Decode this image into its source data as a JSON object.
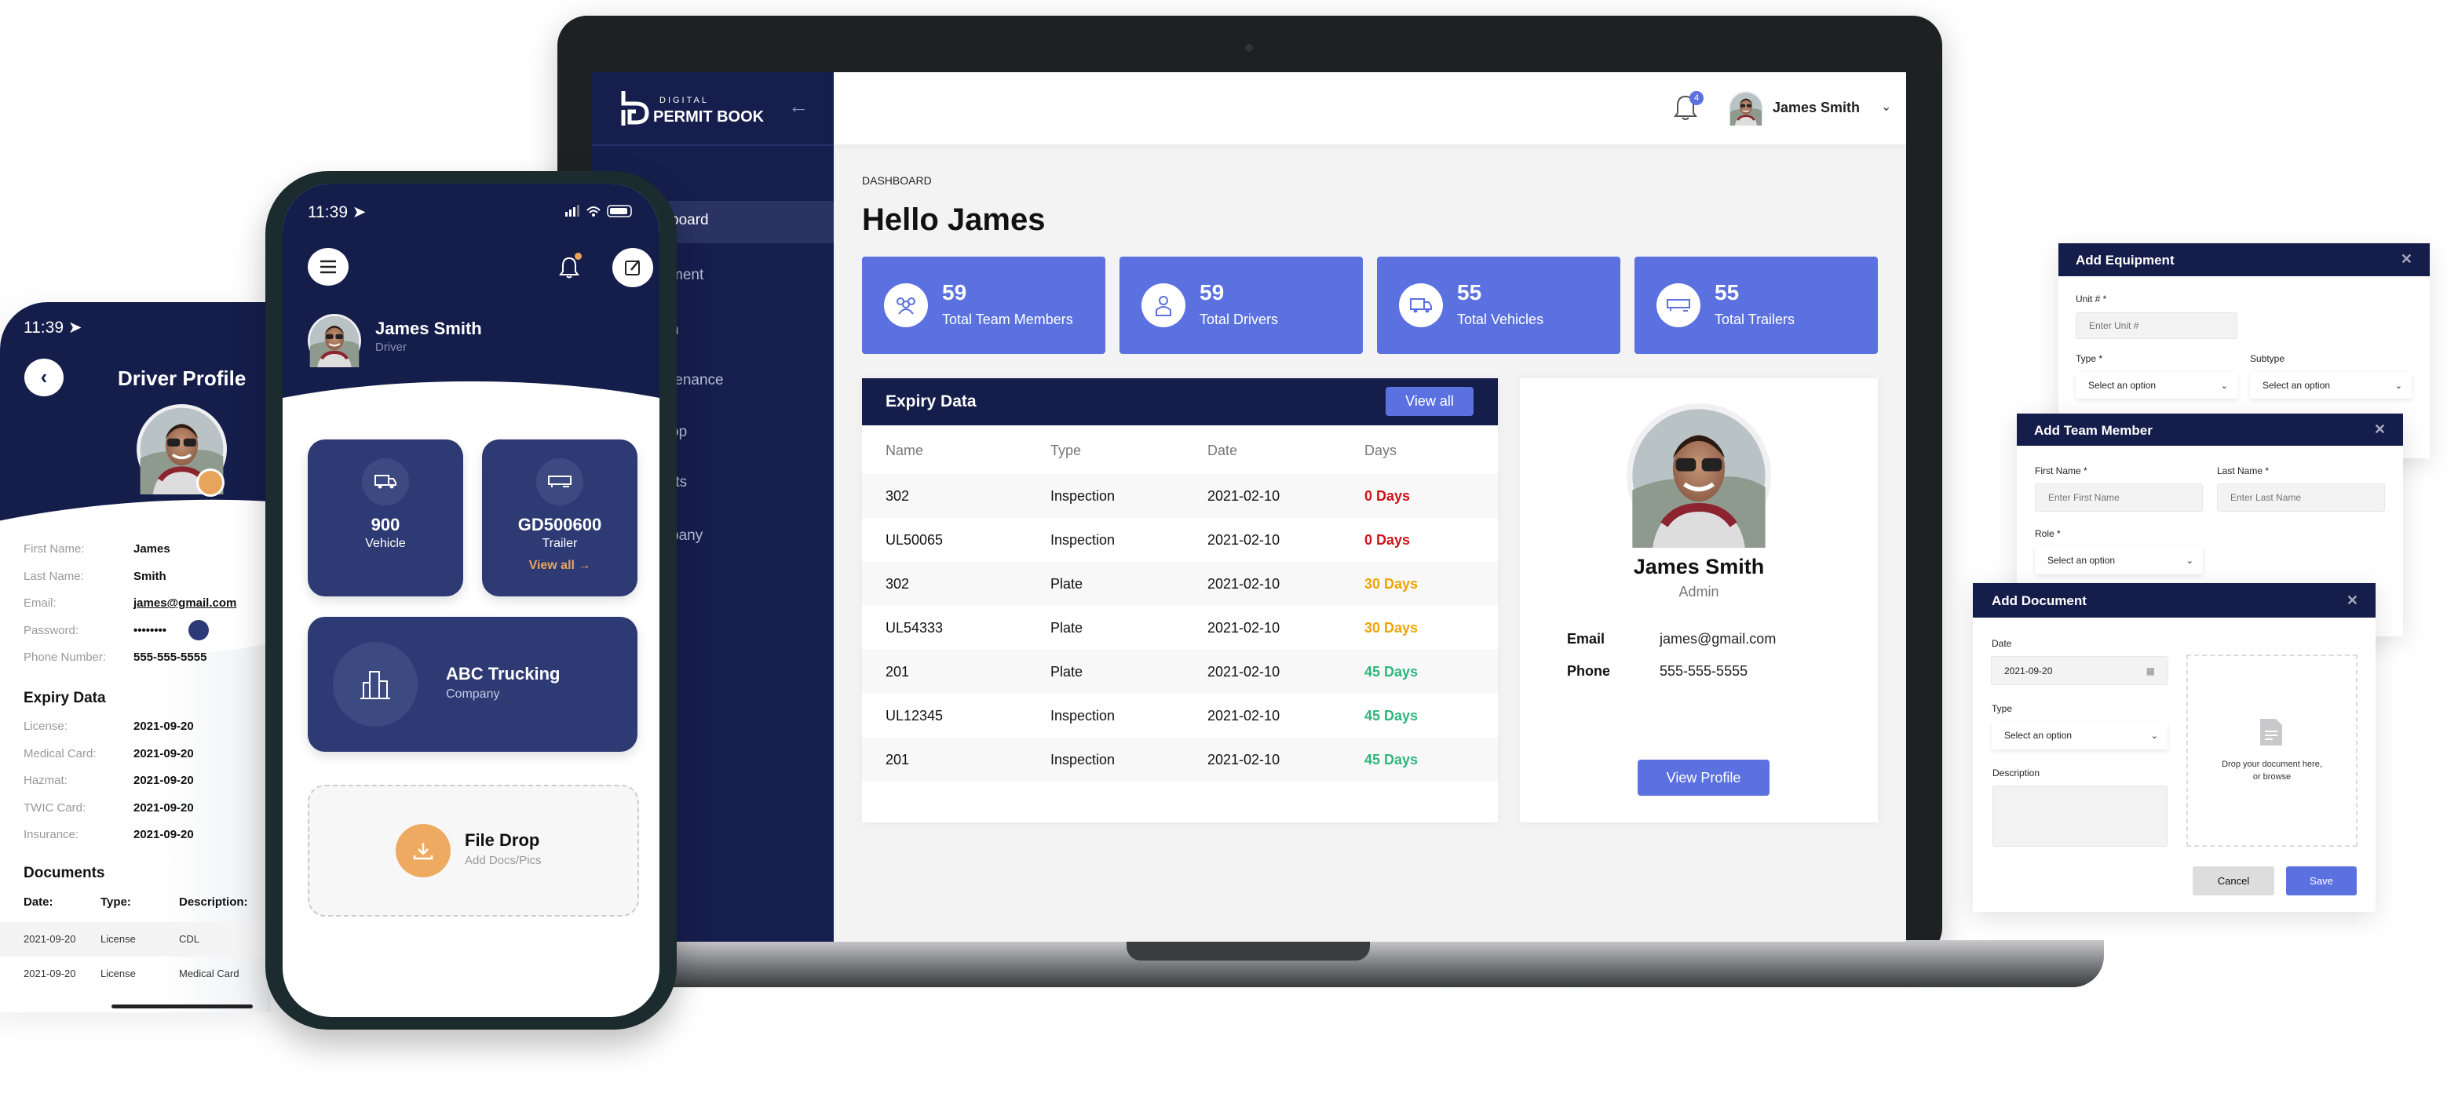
{
  "laptop": {
    "logo": {
      "top": "DIGITAL",
      "main": "PERMIT BOOK"
    },
    "sidebar": {
      "items": [
        {
          "label": "board",
          "active": true
        },
        {
          "label": "ment"
        },
        {
          "label": "n"
        },
        {
          "label": "tenance"
        },
        {
          "label": "op"
        },
        {
          "label": "rts"
        },
        {
          "label": "pany"
        }
      ]
    },
    "header": {
      "notification_count": "4",
      "user_name": "James Smith"
    },
    "breadcrumb": "DASHBOARD",
    "greeting": "Hello James",
    "stats": [
      {
        "value": "59",
        "label": "Total Team Members",
        "icon": "team-icon"
      },
      {
        "value": "59",
        "label": "Total Drivers",
        "icon": "driver-icon"
      },
      {
        "value": "55",
        "label": "Total Vehicles",
        "icon": "truck-icon"
      },
      {
        "value": "55",
        "label": "Total Trailers",
        "icon": "trailer-icon"
      }
    ],
    "expiry": {
      "title": "Expiry Data",
      "view_all": "View all",
      "columns": [
        "Name",
        "Type",
        "Date",
        "Days"
      ],
      "rows": [
        {
          "name": "302",
          "type": "Inspection",
          "date": "2021-02-10",
          "days": "0 Days",
          "color": "#d0121b"
        },
        {
          "name": "UL50065",
          "type": "Inspection",
          "date": "2021-02-10",
          "days": "0 Days",
          "color": "#d0121b"
        },
        {
          "name": "302",
          "type": "Plate",
          "date": "2021-02-10",
          "days": "30 Days",
          "color": "#f0a400"
        },
        {
          "name": "UL54333",
          "type": "Plate",
          "date": "2021-02-10",
          "days": "30 Days",
          "color": "#f0a400"
        },
        {
          "name": "201",
          "type": "Plate",
          "date": "2021-02-10",
          "days": "45 Days",
          "color": "#2fb67c"
        },
        {
          "name": "UL12345",
          "type": "Inspection",
          "date": "2021-02-10",
          "days": "45 Days",
          "color": "#2fb67c"
        },
        {
          "name": "201",
          "type": "Inspection",
          "date": "2021-02-10",
          "days": "45 Days",
          "color": "#2fb67c"
        }
      ]
    },
    "profile": {
      "name": "James Smith",
      "role": "Admin",
      "email_label": "Email",
      "email": "james@gmail.com",
      "phone_label": "Phone",
      "phone": "555-555-5555",
      "button": "View Profile"
    }
  },
  "driver_profile": {
    "time": "11:39",
    "title": "Driver Profile",
    "fields": [
      {
        "label": "First Name:",
        "value": "James"
      },
      {
        "label": "Last Name:",
        "value": "Smith"
      },
      {
        "label": "Email:",
        "value": "james@gmail.com"
      },
      {
        "label": "Password:",
        "value": "••••••••"
      },
      {
        "label": "Phone Number:",
        "value": "555-555-5555"
      }
    ],
    "expiry_heading": "Expiry Data",
    "expiry": [
      {
        "label": "License:",
        "value": "2021-09-20"
      },
      {
        "label": "Medical Card:",
        "value": "2021-09-20"
      },
      {
        "label": "Hazmat:",
        "value": "2021-09-20"
      },
      {
        "label": "TWIC Card:",
        "value": "2021-09-20"
      },
      {
        "label": "Insurance:",
        "value": "2021-09-20"
      }
    ],
    "documents_heading": "Documents",
    "doc_columns": [
      "Date:",
      "Type:",
      "Description:"
    ],
    "documents": [
      {
        "date": "2021-09-20",
        "type": "License",
        "description": "CDL"
      },
      {
        "date": "2021-09-20",
        "type": "License",
        "description": "Medical Card"
      }
    ]
  },
  "mobile": {
    "time": "11:39",
    "user_name": "James Smith",
    "user_role": "Driver",
    "vehicle": {
      "value": "900",
      "label": "Vehicle"
    },
    "trailer": {
      "value": "GD500600",
      "label": "Trailer",
      "link": "View all →"
    },
    "company": {
      "name": "ABC Trucking",
      "label": "Company"
    },
    "file_drop": {
      "title": "File Drop",
      "subtitle": "Add Docs/Pics"
    }
  },
  "modals": {
    "equipment": {
      "title": "Add Equipment",
      "unit_label": "Unit # *",
      "unit_placeholder": "Enter Unit #",
      "type_label": "Type *",
      "type_value": "Select an option",
      "subtype_label": "Subtype",
      "subtype_value": "Select an option"
    },
    "team_member": {
      "title": "Add Team Member",
      "first_label": "First Name *",
      "first_placeholder": "Enter First Name",
      "last_label": "Last Name *",
      "last_placeholder": "Enter Last Name",
      "role_label": "Role *",
      "role_value": "Select an option"
    },
    "document": {
      "title": "Add Document",
      "date_label": "Date",
      "date_value": "2021-09-20",
      "type_label": "Type",
      "type_value": "Select an option",
      "description_label": "Description",
      "drop_line1": "Drop your document here,",
      "drop_line2": "or browse",
      "cancel": "Cancel",
      "save": "Save"
    }
  },
  "colors": {
    "navy": "#151d4b",
    "accent": "#5b71e0",
    "orange": "#eeaa60"
  }
}
